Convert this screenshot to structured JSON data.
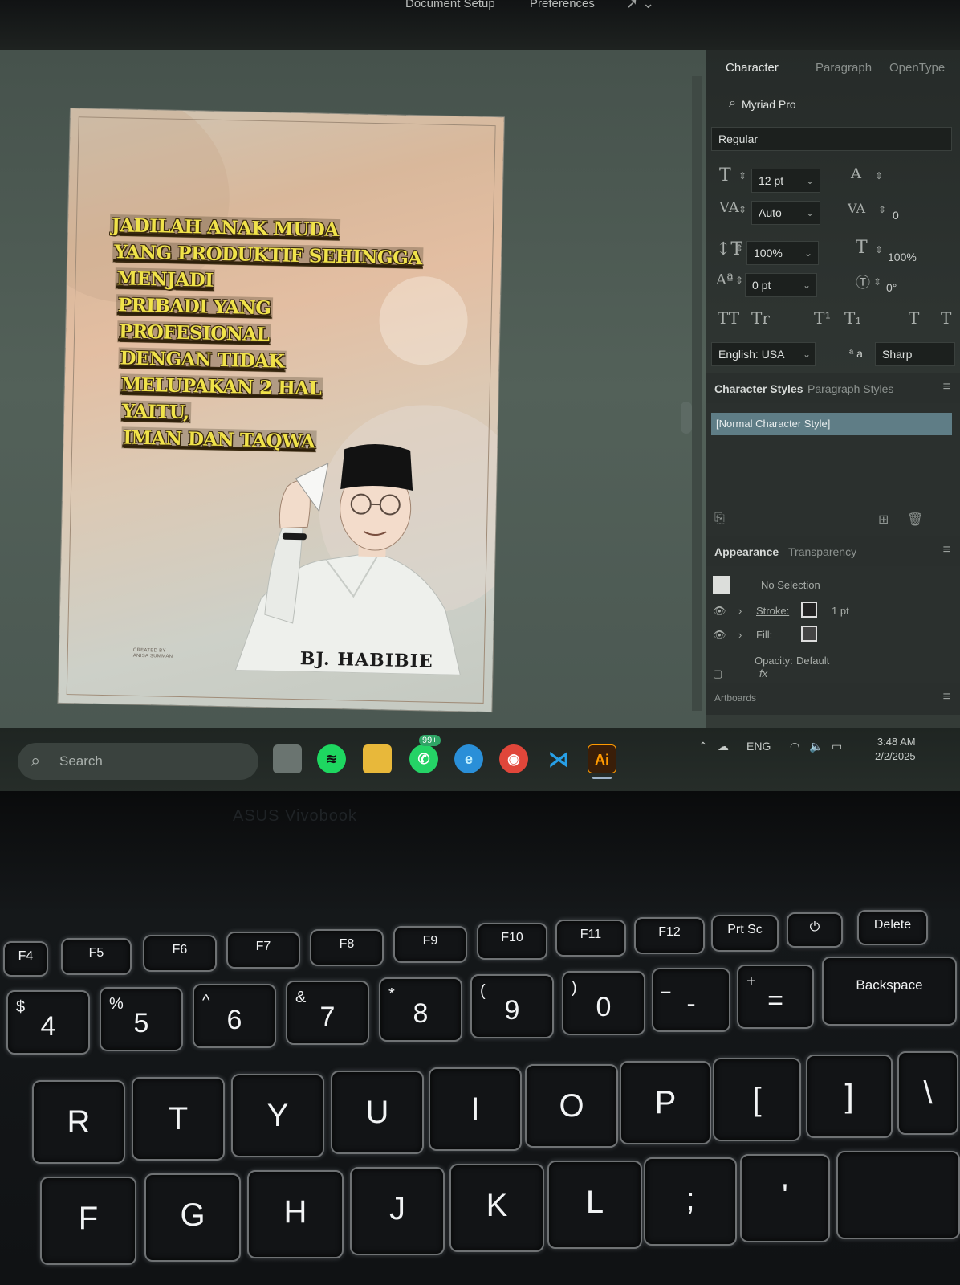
{
  "menubar": {
    "items": [
      "Document Setup",
      "Preferences"
    ]
  },
  "poster": {
    "quote_lines": [
      "JADILAH ANAK MUDA",
      "YANG PRODUKTIF SEHINGGA",
      "MENJADI",
      "PRIBADI YANG",
      "PROFESIONAL",
      "DENGAN TIDAK",
      "MELUPAKAN 2 HAL",
      "YAITU,",
      "IMAN DAN TAQWA"
    ],
    "name": "BJ. HABIBIE",
    "credit_line1": "CREATED BY",
    "credit_line2": "ANISA SUMMAN"
  },
  "character_panel": {
    "tabs": [
      "Character",
      "Paragraph",
      "OpenType"
    ],
    "font_family": "Myriad Pro",
    "font_style": "Regular",
    "font_size": "12 pt",
    "leading": "",
    "kerning": "Auto",
    "tracking": "0",
    "vertical_scale": "100%",
    "horizontal_scale": "100%",
    "baseline_shift": "0 pt",
    "rotation": "0°",
    "language": "English: USA",
    "antialias_glyph": "ª a",
    "antialias": "Sharp"
  },
  "styles_panel": {
    "tabs": [
      "Character Styles",
      "Paragraph Styles"
    ],
    "items": [
      "[Normal Character Style]"
    ]
  },
  "appearance_panel": {
    "tabs": [
      "Appearance",
      "Transparency"
    ],
    "selection": "No Selection",
    "stroke_label": "Stroke:",
    "stroke_value": "1 pt",
    "fill_label": "Fill:",
    "opacity_label": "Opacity:",
    "opacity_value": "Default",
    "fx_label": "fx"
  },
  "artboards_panel": {
    "title": "Artboards"
  },
  "taskbar": {
    "search_placeholder": "Search",
    "whatsapp_badge": "99+",
    "ai_label": "Ai",
    "language": "ENG",
    "time": "3:48 AM",
    "date": "2/2/2025"
  },
  "laptop": {
    "brand": "ASUS Vivobook"
  },
  "keyboard": {
    "fkeys": [
      "F4",
      "F5",
      "F6",
      "F7",
      "F8",
      "F9",
      "F10",
      "F11",
      "F12",
      "Prt Sc",
      "⏻",
      "Delete"
    ],
    "number_row": [
      {
        "shift": "$",
        "main": "4"
      },
      {
        "shift": "%",
        "main": "5"
      },
      {
        "shift": "^",
        "main": "6"
      },
      {
        "shift": "&",
        "main": "7"
      },
      {
        "shift": "*",
        "main": "8"
      },
      {
        "shift": "(",
        "main": "9"
      },
      {
        "shift": ")",
        "main": "0"
      },
      {
        "shift": "_",
        "main": "-"
      },
      {
        "shift": "+",
        "main": "="
      }
    ],
    "backspace": "Backspace",
    "top_letters": [
      "R",
      "T",
      "Y",
      "U",
      "I",
      "O",
      "P",
      "[",
      "]",
      "\\"
    ],
    "home_letters": [
      "F",
      "G",
      "H",
      "J",
      "K",
      "L",
      ";",
      "'"
    ]
  },
  "colors": {
    "quote_text": "#f0e24a",
    "panel_bg": "#2e3431",
    "selected_style": "#5f7d86",
    "keyboard_backlight": "#f2f4f5"
  }
}
